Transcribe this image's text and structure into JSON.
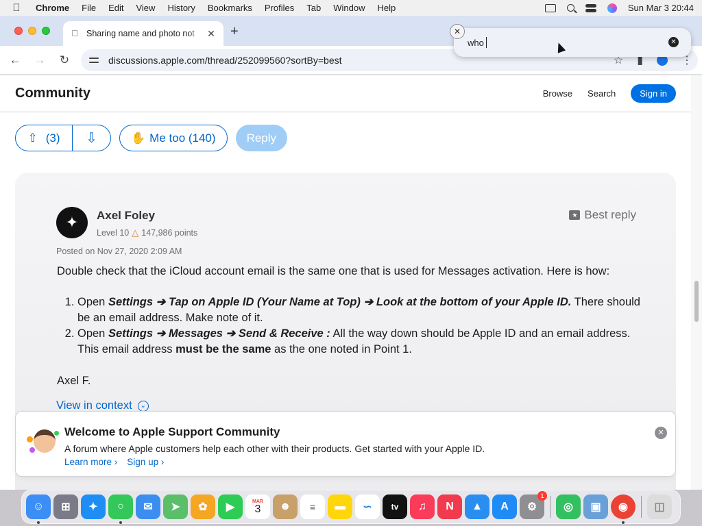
{
  "menubar": {
    "app": "Chrome",
    "items": [
      "File",
      "Edit",
      "View",
      "History",
      "Bookmarks",
      "Profiles",
      "Tab",
      "Window",
      "Help"
    ],
    "datetime": "Sun Mar 3  20:44"
  },
  "browser": {
    "tab_title": "Sharing name and photo not",
    "url": "discussions.apple.com/thread/252099560?sortBy=best",
    "find_query": "who"
  },
  "site": {
    "brand": "Community",
    "nav": {
      "browse": "Browse",
      "search": "Search",
      "sign_in": "Sign in"
    }
  },
  "actions": {
    "upvote_count": "(3)",
    "me_too": "Me too (140)",
    "reply": "Reply"
  },
  "post": {
    "author": "Axel Foley",
    "level": "Level 10",
    "points": "147,986 points",
    "best_reply": "Best reply",
    "posted": "Posted on Nov 27, 2020 2:09 AM",
    "intro": "Double check that the iCloud account email is the same one that is used for Messages activation. Here is how:",
    "step1_open": "Open ",
    "step1_bold": "Settings ➔ Tap on Apple ID (Your Name at Top) ➔ Look at the bottom of your Apple ID.",
    "step1_rest": " There should be an email address. Make note of it.",
    "step2_open": "Open ",
    "step2_bold": "Settings ➔ Messages ➔ Send & Receive :",
    "step2_mid": " All the way down should be Apple ID and an email address. This email address ",
    "step2_strong": "must be the same",
    "step2_end": " as the one noted in Point 1.",
    "signature": "Axel F.",
    "view_context": "View in context"
  },
  "welcome": {
    "title": "Welcome to Apple Support Community",
    "description": "A forum where Apple customers help each other with their products. Get started with your Apple ID.",
    "learn_more": "Learn more ›",
    "sign_up": "Sign up ›"
  },
  "dock": {
    "calendar_month": "MAR",
    "calendar_day": "3",
    "settings_badge": "1",
    "tv_label": "tv",
    "colors": {
      "finder": "#3a8ef6",
      "launchpad": "#7a7a88",
      "safari": "#1e8ef5",
      "messages": "#34c759",
      "mail": "#3b8ef0",
      "maps": "#5bbf6a",
      "photos": "#f5a623",
      "facetime": "#2ecc55",
      "calendar": "#ffffff",
      "contacts": "#c8a06a",
      "reminders": "#ffffff",
      "notes": "#ffd60a",
      "freeform": "#ffffff",
      "tv": "#111111",
      "music": "#fa3c5a",
      "news": "#f13a4e",
      "keynote": "#2a8ef0",
      "appstore": "#1f8cf5",
      "settings": "#8e8e93",
      "findmy": "#33c060",
      "preview": "#6aa0d8",
      "chrome": "#ea4335",
      "trash": "#dcdcdc"
    }
  }
}
